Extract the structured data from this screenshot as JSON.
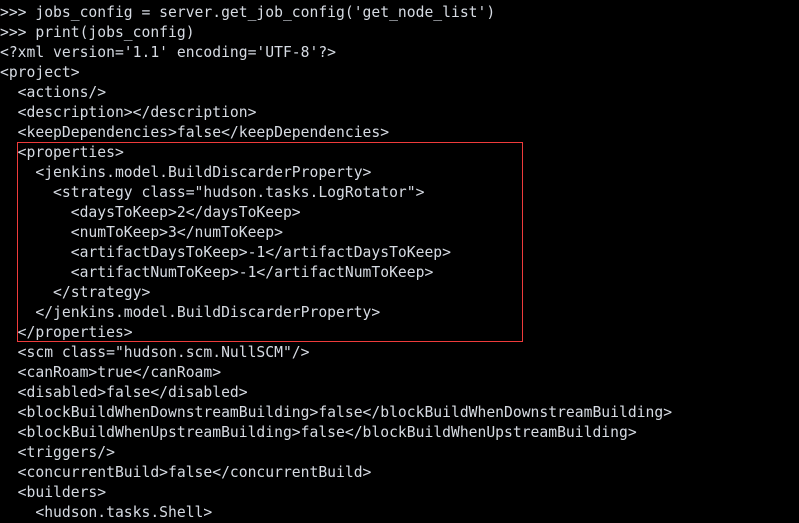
{
  "terminal": {
    "background_color": "#000000",
    "text_color": "#d6dbe3",
    "annotation_color": "#ee3b3b",
    "lines": [
      ">>> jobs_config = server.get_job_config('get_node_list')",
      ">>> print(jobs_config)",
      "<?xml version='1.1' encoding='UTF-8'?>",
      "<project>",
      "  <actions/>",
      "  <description></description>",
      "  <keepDependencies>false</keepDependencies>",
      "  <properties>",
      "    <jenkins.model.BuildDiscarderProperty>",
      "      <strategy class=\"hudson.tasks.LogRotator\">",
      "        <daysToKeep>2</daysToKeep>",
      "        <numToKeep>3</numToKeep>",
      "        <artifactDaysToKeep>-1</artifactDaysToKeep>",
      "        <artifactNumToKeep>-1</artifactNumToKeep>",
      "      </strategy>",
      "    </jenkins.model.BuildDiscarderProperty>",
      "  </properties>",
      "  <scm class=\"hudson.scm.NullSCM\"/>",
      "  <canRoam>true</canRoam>",
      "  <disabled>false</disabled>",
      "  <blockBuildWhenDownstreamBuilding>false</blockBuildWhenDownstreamBuilding>",
      "  <blockBuildWhenUpstreamBuilding>false</blockBuildWhenUpstreamBuilding>",
      "  <triggers/>",
      "  <concurrentBuild>false</concurrentBuild>",
      "  <builders>",
      "    <hudson.tasks.Shell>"
    ],
    "annotation": {
      "label": "properties-block-highlight",
      "covers_lines": [
        "  <properties>",
        "    <jenkins.model.BuildDiscarderProperty>",
        "      <strategy class=\"hudson.tasks.LogRotator\">",
        "        <daysToKeep>2</daysToKeep>",
        "        <numToKeep>3</numToKeep>",
        "        <artifactDaysToKeep>-1</artifactDaysToKeep>",
        "        <artifactNumToKeep>-1</artifactNumToKeep>",
        "      </strategy>",
        "    </jenkins.model.BuildDiscarderProperty>",
        "  </properties>"
      ]
    }
  }
}
